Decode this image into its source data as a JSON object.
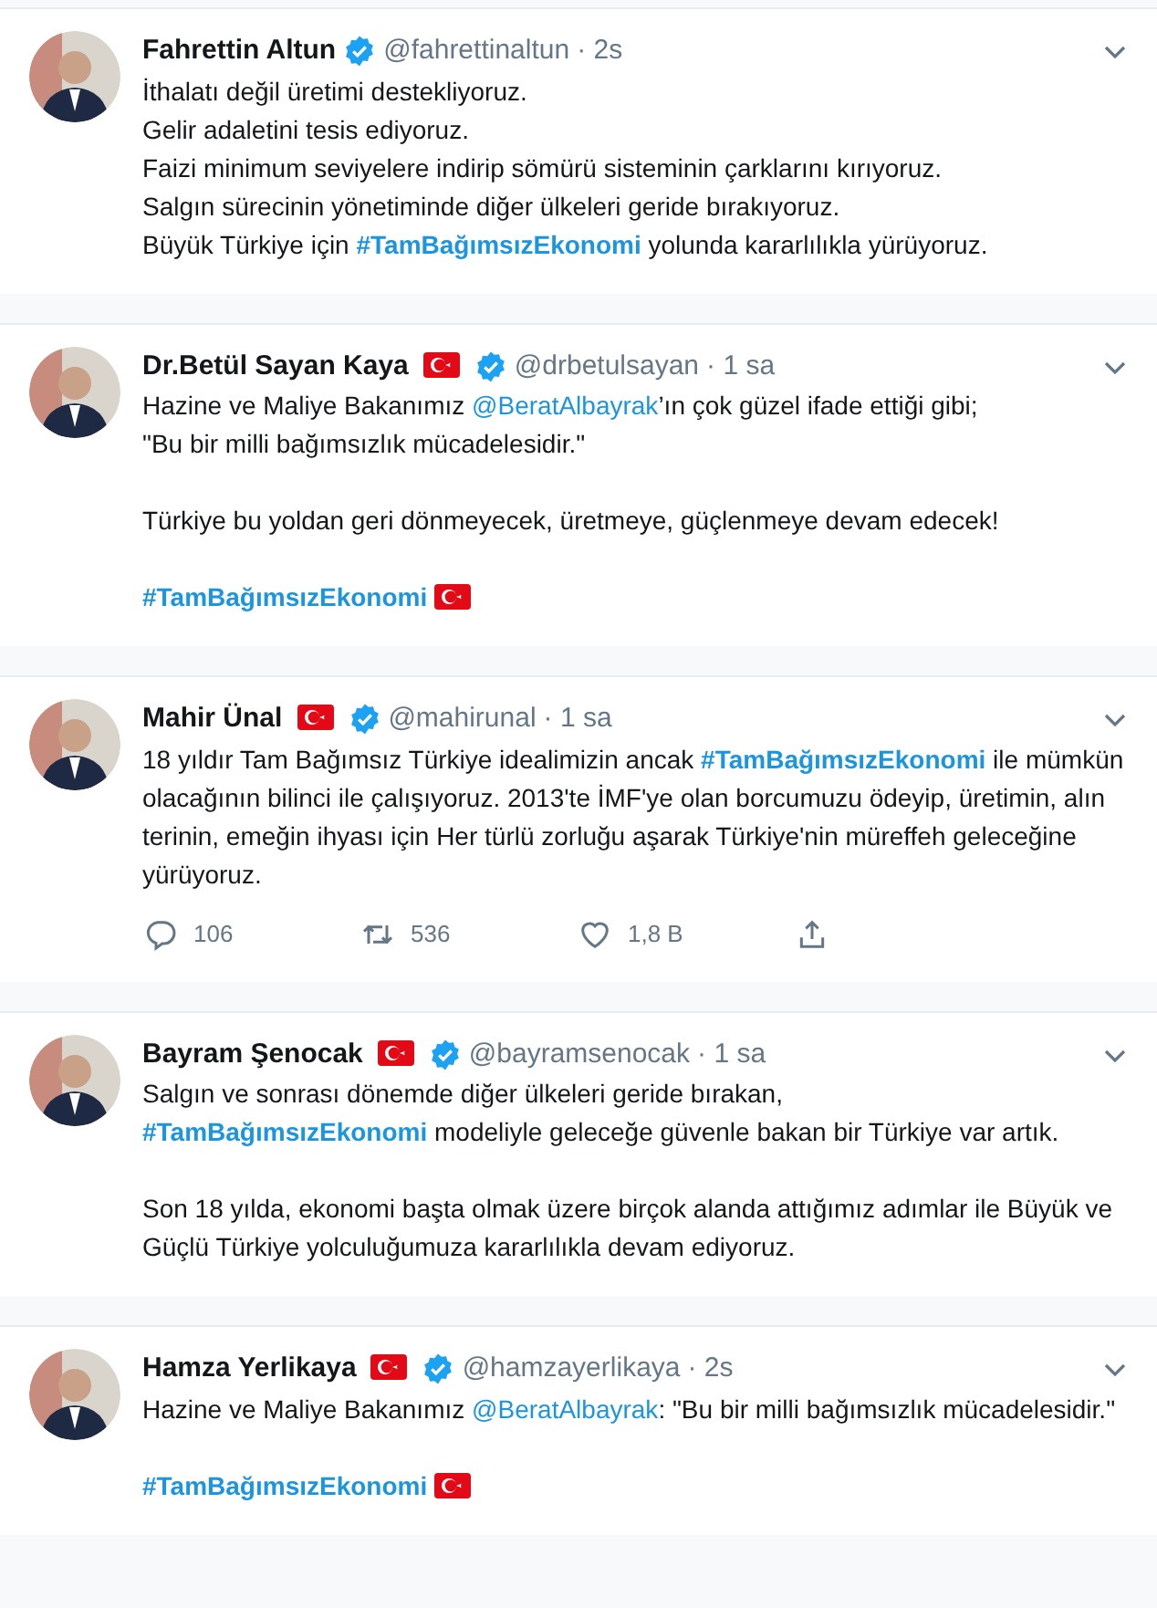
{
  "tweets": [
    {
      "name": "Fahrettin Altun",
      "flag": false,
      "verified": true,
      "handle": "@fahrettinaltun",
      "time": "· 2s",
      "paragraphs": [
        [
          [
            {
              "kind": "text",
              "text": "İthalatı değil üretimi destekliyoruz."
            }
          ],
          [
            {
              "kind": "text",
              "text": "Gelir adaletini tesis ediyoruz."
            }
          ],
          [
            {
              "kind": "text",
              "text": "Faizi minimum seviyelere indirip sömürü sisteminin çarklarını kırıyoruz."
            }
          ],
          [
            {
              "kind": "text",
              "text": "Salgın sürecinin yönetiminde diğer ülkeleri geride bırakıyoruz."
            }
          ],
          [
            {
              "kind": "text",
              "text": "Büyük Türkiye için "
            },
            {
              "kind": "hashtag",
              "text": "#TamBağımsızEkonomi"
            },
            {
              "kind": "text",
              "text": " yolunda kararlılıkla yürüyoruz."
            }
          ]
        ]
      ]
    },
    {
      "name": "Dr.Betül Sayan Kaya",
      "flag": true,
      "verified": true,
      "handle": "@drbetulsayan",
      "time": "· 1 sa",
      "paragraphs": [
        [
          [
            {
              "kind": "text",
              "text": "Hazine ve Maliye Bakanımız "
            },
            {
              "kind": "mention",
              "text": "@BeratAlbayrak"
            },
            {
              "kind": "text",
              "text": "’ın çok güzel ifade ettiği gibi;"
            }
          ],
          [
            {
              "kind": "text",
              "text": "\"Bu bir milli bağımsızlık mücadelesidir.\""
            }
          ]
        ],
        [
          [
            {
              "kind": "text",
              "text": "Türkiye bu yoldan geri dönmeyecek, üretmeye, güçlenmeye devam edecek!"
            }
          ]
        ],
        [
          [
            {
              "kind": "hashtag",
              "text": "#TamBağımsızEkonomi"
            },
            {
              "kind": "flag"
            }
          ]
        ]
      ]
    },
    {
      "name": "Mahir Ünal",
      "flag": true,
      "verified": true,
      "handle": "@mahirunal",
      "time": "· 1 sa",
      "paragraphs": [
        [
          [
            {
              "kind": "text",
              "text": "18 yıldır Tam Bağımsız Türkiye  idealimizin ancak "
            },
            {
              "kind": "hashtag",
              "text": "#TamBağımsızEkonomi"
            },
            {
              "kind": "text",
              "text": " ile mümkün olacağının bilinci ile çalışıyoruz. 2013'te İMF'ye olan borcumuzu ödeyip, üretimin, alın terinin, emeğin ihyası için Her türlü zorluğu aşarak Türkiye'nin müreffeh geleceğine yürüyoruz."
            }
          ]
        ]
      ],
      "actions": [
        {
          "kind": "reply",
          "count": "106"
        },
        {
          "kind": "retweet",
          "count": "536"
        },
        {
          "kind": "like",
          "count": "1,8 B"
        },
        {
          "kind": "share"
        }
      ]
    },
    {
      "name": "Bayram Şenocak",
      "flag": true,
      "verified": true,
      "handle": "@bayramsenocak",
      "time": "· 1 sa",
      "paragraphs": [
        [
          [
            {
              "kind": "text",
              "text": "Salgın ve sonrası dönemde diğer ülkeleri geride bırakan,"
            }
          ],
          [
            {
              "kind": "hashtag",
              "text": "#TamBağımsızEkonomi"
            },
            {
              "kind": "text",
              "text": " modeliyle geleceğe güvenle bakan bir Türkiye var artık."
            }
          ]
        ],
        [
          [
            {
              "kind": "text",
              "text": "Son 18 yılda, ekonomi başta olmak üzere birçok alanda attığımız adımlar ile Büyük ve Güçlü Türkiye yolculuğumuza kararlılıkla devam ediyoruz."
            }
          ]
        ]
      ]
    },
    {
      "name": "Hamza Yerlikaya",
      "flag": true,
      "verified": true,
      "handle": "@hamzayerlikaya",
      "time": "· 2s",
      "paragraphs": [
        [
          [
            {
              "kind": "text",
              "text": "Hazine ve Maliye Bakanımız "
            },
            {
              "kind": "mention",
              "text": "@BeratAlbayrak"
            },
            {
              "kind": "text",
              "text": ": \"Bu bir milli bağımsızlık mücadelesidir.\""
            }
          ]
        ],
        [
          [
            {
              "kind": "hashtag",
              "text": "#TamBağımsızEkonomi"
            },
            {
              "kind": "flag"
            }
          ]
        ]
      ]
    }
  ]
}
